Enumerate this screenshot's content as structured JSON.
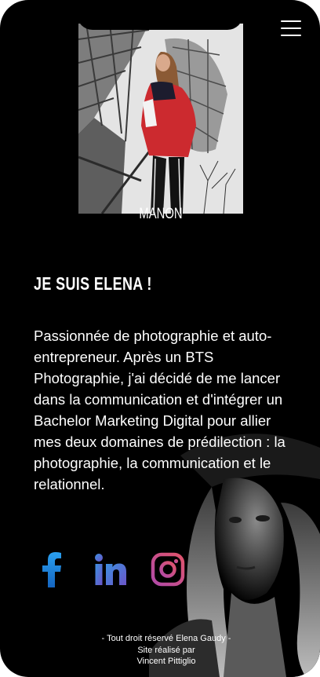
{
  "hero": {
    "caption": "MANON"
  },
  "about": {
    "heading": "JE SUIS ELENA !",
    "bio": "Passionnée de photographie et auto-entrepreneur. Après un BTS Photographie, j'ai décidé de me lancer dans la communication et d'intégrer un Bachelor Marketing Digital pour allier mes deux domaines de prédilection : la photographie, la communication et le relationnel."
  },
  "social": {
    "facebook_icon": "facebook-icon",
    "linkedin_icon": "linkedin-icon",
    "instagram_icon": "instagram-icon",
    "facebook_color": "#1f8fe8",
    "linkedin_color": "#5a6fd6",
    "instagram_color": "#c8479a"
  },
  "footer": {
    "rights": "- Tout droit réservé Elena Gaudy -",
    "made_by": "Site réalisé par",
    "author": "Vincent Pittiglio"
  },
  "menu_icon": "hamburger-menu-icon"
}
